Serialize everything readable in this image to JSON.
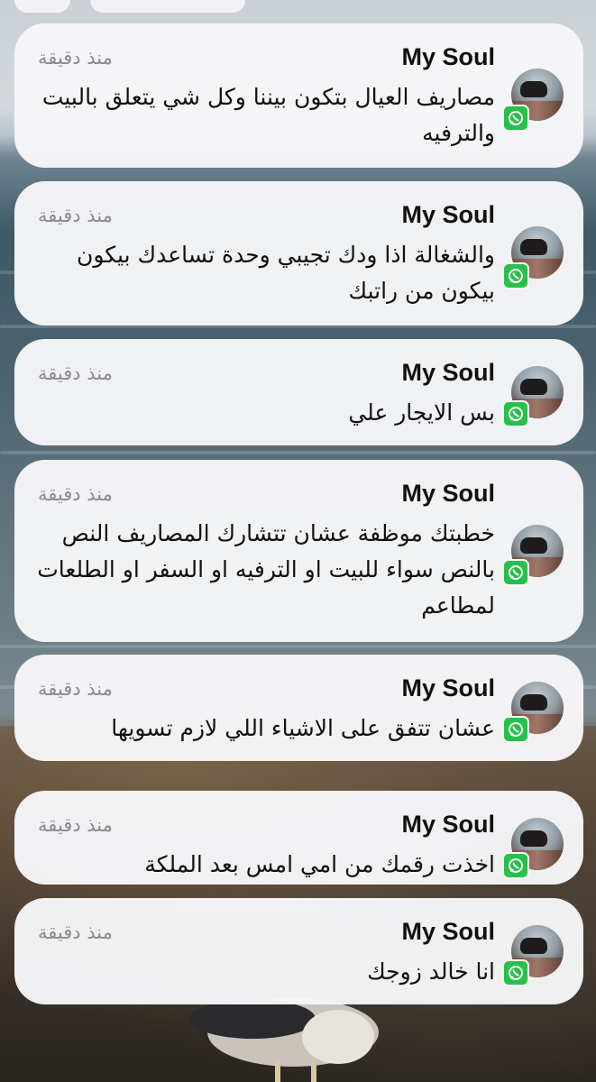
{
  "notifications": [
    {
      "app": "whatsapp",
      "title": "My Soul",
      "time": "منذ دقيقة",
      "message": "مصاريف العيال بتكون بيننا وكل شي يتعلق بالبيت والترفيه"
    },
    {
      "app": "whatsapp",
      "title": "My Soul",
      "time": "منذ دقيقة",
      "message": "والشغالة اذا ودك تجيبي وحدة تساعدك بيكون بيكون من راتبك"
    },
    {
      "app": "whatsapp",
      "title": "My Soul",
      "time": "منذ دقيقة",
      "message": "بس الايجار علي"
    },
    {
      "app": "whatsapp",
      "title": "My Soul",
      "time": "منذ دقيقة",
      "message": "خطبتك موظفة عشان تتشارك المصاريف النص بالنص سواء للبيت او الترفيه او السفر او الطلعات لمطاعم"
    },
    {
      "app": "whatsapp",
      "title": "My Soul",
      "time": "منذ دقيقة",
      "message": "عشان تتفق على الاشياء اللي لازم تسويها"
    },
    {
      "app": "whatsapp",
      "title": "My Soul",
      "time": "منذ دقيقة",
      "message": "اخذت رقمك من امي امس بعد الملكة"
    },
    {
      "app": "whatsapp",
      "title": "My Soul",
      "time": "منذ دقيقة",
      "message": "انا خالد زوجك"
    }
  ],
  "colors": {
    "card_background": "#f6f6f8",
    "whatsapp_green": "#27c04a",
    "time_gray": "#8a8a8e"
  }
}
